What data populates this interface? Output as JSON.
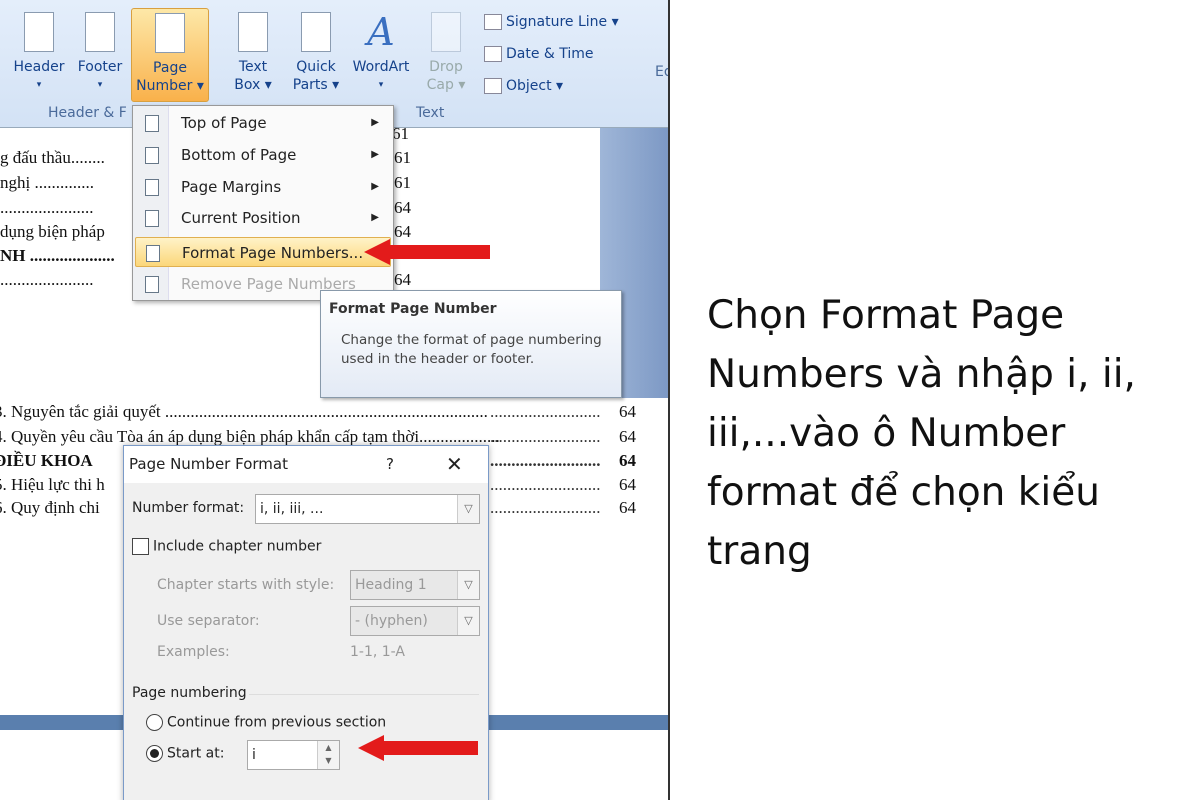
{
  "ribbon": {
    "buttons": [
      {
        "label1": "Header",
        "label2": "▾"
      },
      {
        "label1": "Footer",
        "label2": "▾"
      },
      {
        "label1": "Page",
        "label2": "Number ▾"
      },
      {
        "label1": "Text",
        "label2": "Box ▾"
      },
      {
        "label1": "Quick",
        "label2": "Parts ▾"
      },
      {
        "label1": "WordArt",
        "label2": "▾"
      },
      {
        "label1": "Drop",
        "label2": "Cap ▾"
      }
    ],
    "small": [
      "Signature Line ▾",
      "Date & Time",
      "Object ▾"
    ],
    "groups": [
      "Header & F",
      "Text",
      "Ed"
    ]
  },
  "document": {
    "lines_top": [
      {
        "text": "g đấu thầu........",
        "page": "61"
      },
      {
        "text": "nghị ..............",
        "page": "61"
      },
      {
        "text": "......................",
        "page": "64"
      },
      {
        "text": " dụng biện pháp",
        "page": "64"
      },
      {
        "text": "NH ....................",
        "page": ""
      },
      {
        "text": "......................",
        "page": "64"
      }
    ],
    "top_partial_page": "61",
    "lines_bottom": [
      {
        "text": "3. Nguyên tắc giải quyết ............................................................................ ",
        "page": "64"
      },
      {
        "text": "4. Quyền yêu cầu Tòa án áp dụng biện pháp khẩn cấp tạm thời...................",
        "page": "64"
      },
      {
        "text": " ĐIỀU KHOA",
        "page": "64"
      },
      {
        "text": "5. Hiệu lực thi h",
        "page": "64"
      },
      {
        "text": "6. Quy định chi",
        "page": "64"
      }
    ]
  },
  "menu": {
    "items": [
      {
        "label": "Top of Page",
        "submenu": true,
        "icon": "page-top-icon"
      },
      {
        "label": "Bottom of Page",
        "submenu": true,
        "icon": "page-bottom-icon"
      },
      {
        "label": "Page Margins",
        "submenu": true,
        "icon": "page-margins-icon"
      },
      {
        "label": "Current Position",
        "submenu": true,
        "icon": "current-position-icon"
      },
      {
        "label": "Format Page Numbers...",
        "highlighted": true,
        "icon": "format-page-numbers-icon"
      },
      {
        "label": "Remove Page Numbers",
        "disabled": true,
        "icon": "remove-page-numbers-icon"
      }
    ]
  },
  "tooltip": {
    "title": "Format Page Number",
    "body": "Change the format of page numbering used in the header or footer."
  },
  "dialog": {
    "title": "Page Number Format",
    "help": "?",
    "close": "✕",
    "number_format_label": "Number format:",
    "number_format_value": "i, ii, iii, ...",
    "include_chapter": "Include chapter number",
    "include_chapter_checked": false,
    "chapter_style_label": "Chapter starts with style:",
    "chapter_style_value": "Heading 1",
    "separator_label": "Use separator:",
    "separator_value": "-  (hyphen)",
    "examples_label": "Examples:",
    "examples_value": "1-1, 1-A",
    "page_numbering_label": "Page numbering",
    "continue_label": "Continue from previous section",
    "start_at_label": "Start at:",
    "start_at_value": "i",
    "selected_option": "start_at"
  },
  "caption": "Chọn Format Page Numbers và nhập i, ii, iii,...vào ô Number format để chọn kiểu trang",
  "colors": {
    "arrow": "#e31b1b",
    "highlight": "#fbd77a",
    "ribbon": "#d3e2f5"
  }
}
